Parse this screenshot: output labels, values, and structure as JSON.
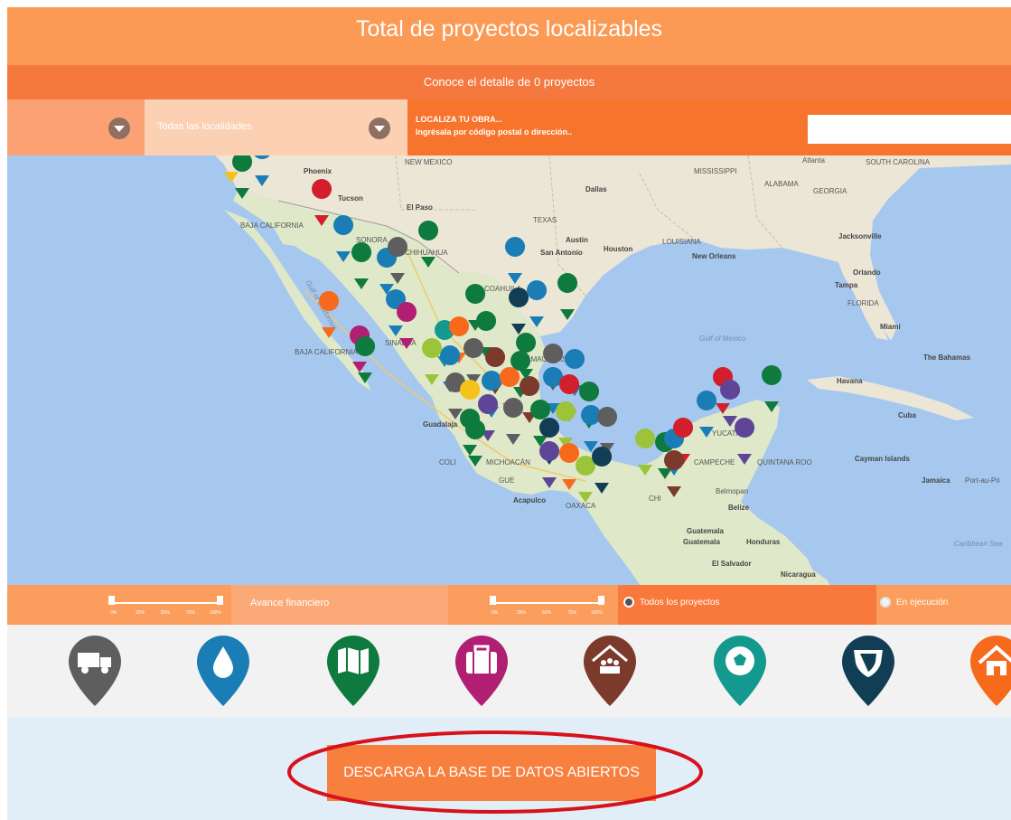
{
  "header": {
    "title": "Total de proyectos localizables",
    "subtitle": "Conoce el detalle de 0 proyectos"
  },
  "filters": {
    "locality_label": "Todas las localidades",
    "localiza_title": "LOCALIZA TU OBRA...",
    "localiza_hint": "Ingrésala por código postal o dirección..",
    "search_value": ""
  },
  "map": {
    "labels": {
      "new_mexico": "NEW MEXICO",
      "mississippi": "MISSISSIPPI",
      "alabama": "ALABAMA",
      "georgia": "GEORGIA",
      "atlanta": "Atlanta",
      "south_carolina": "SOUTH CAROLINA",
      "phoenix": "Phoenix",
      "tucson": "Tucson",
      "el_paso": "El Paso",
      "dallas": "Dallas",
      "texas": "TEXAS",
      "austin": "Austin",
      "houston": "Houston",
      "san_antonio": "San Antonio",
      "louisiana": "LOUISIANA",
      "new_orleans": "New Orleans",
      "jacksonville": "Jacksonville",
      "orlando": "Orlando",
      "tampa": "Tampa",
      "florida": "FLORIDA",
      "miami": "Miami",
      "baja_california": "BAJA CALIFORNIA",
      "baja_california_sur": "BAJA CALIFORNIA",
      "gulf_california": "Gulf of California",
      "gulf_mexico": "Gulf of Mexico",
      "bahamas": "The Bahamas",
      "havana": "Havana",
      "cuba": "Cuba",
      "cayman": "Cayman Islands",
      "jamaica": "Jamaica",
      "port_au_prince": "Port-au-Pri",
      "coahuila": "COAHUILA",
      "tamaulipas": "TAMAULIPAS",
      "guadalajara": "Guadalaja",
      "michoacan": "MICHOACÁN",
      "acapulco": "Acapulco",
      "oaxaca": "OAXACA",
      "yucatan": "YUCATÁN",
      "campeche": "CAMPECHE",
      "quintana": "QUINTANA ROO",
      "belmopan": "Belmopan",
      "belize": "Belize",
      "guatemala": "Guatemala",
      "guatemala_city": "Guatemala",
      "honduras": "Honduras",
      "el_salvador": "El Salvador",
      "nicaragua": "Nicaragua",
      "caribbean": "Caribbean Sea",
      "sinaloa": "SINALOA",
      "chihuahua": "CHIHUAHUA",
      "sonora": "SONORA",
      "colima": "COLI",
      "guerrero": "GUE",
      "chiapas": "CHI"
    }
  },
  "progress": {
    "avance_label": "Avance financiero",
    "todos_label": "Todos los proyectos",
    "ejecucion_label": "En ejecución",
    "slider_ticks": [
      "0%",
      "25%",
      "50%",
      "75%",
      "100%"
    ],
    "todos_selected": true
  },
  "categories": [
    {
      "icon": "truck-icon",
      "color": "#5e5e5e"
    },
    {
      "icon": "water-drop-icon",
      "color": "#1a7db5"
    },
    {
      "icon": "map-icon",
      "color": "#0e7a3d"
    },
    {
      "icon": "suitcase-icon",
      "color": "#b11f72"
    },
    {
      "icon": "community-house-icon",
      "color": "#7b3a2c"
    },
    {
      "icon": "soccer-ball-icon",
      "color": "#14998f"
    },
    {
      "icon": "shield-icon",
      "color": "#123e55"
    },
    {
      "icon": "house-icon",
      "color": "#f76a1c"
    }
  ],
  "download": {
    "button_label": "DESCARGA LA BASE DE DATOS ABIERTOS",
    "highlight_color": "#d8121c"
  }
}
